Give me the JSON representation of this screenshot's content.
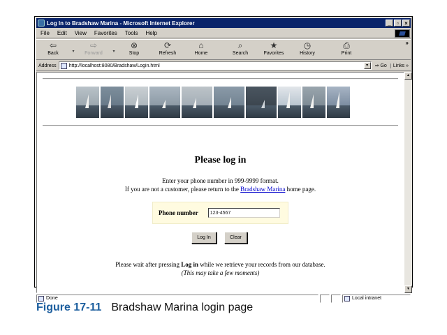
{
  "window": {
    "title": "Log In to Bradshaw Marina - Microsoft Internet Explorer"
  },
  "menu": [
    {
      "label": "File"
    },
    {
      "label": "Edit"
    },
    {
      "label": "View"
    },
    {
      "label": "Favorites"
    },
    {
      "label": "Tools"
    },
    {
      "label": "Help"
    }
  ],
  "toolbar": {
    "back": {
      "label": "Back",
      "icon": "back-arrow-icon"
    },
    "forward": {
      "label": "Forward",
      "icon": "forward-arrow-icon"
    },
    "stop": {
      "label": "Stop",
      "icon": "stop-icon"
    },
    "refresh": {
      "label": "Refresh",
      "icon": "refresh-icon"
    },
    "home": {
      "label": "Home",
      "icon": "home-icon"
    },
    "search": {
      "label": "Search",
      "icon": "search-icon"
    },
    "favorites": {
      "label": "Favorites",
      "icon": "favorites-icon"
    },
    "history": {
      "label": "History",
      "icon": "history-icon"
    },
    "print": {
      "label": "Print",
      "icon": "print-icon"
    },
    "overflow": "»"
  },
  "address": {
    "label": "Address",
    "url": "http://localhost:8080/Bradshaw/Login.html",
    "go": "Go",
    "links": "Links »"
  },
  "page": {
    "heading": "Please log in",
    "instruction1": "Enter your phone number in 999-9999 format.",
    "instruction2_pre": "If you are not a customer, please return to the ",
    "instruction2_link": "Bradshaw Marina",
    "instruction2_post": " home page.",
    "phone_label": "Phone number",
    "phone_value": "123-4567",
    "login_button": "Log In",
    "clear_button": "Clear",
    "wait_pre": "Please wait after pressing ",
    "wait_bold": "Log in",
    "wait_post": " while we retrieve your records from our database.",
    "wait_note": "(This may take a few moments)",
    "photo_count_note": "sailboat photos"
  },
  "status": {
    "text": "Done",
    "zone": "Local intranet"
  },
  "caption": {
    "number": "Figure 17-11",
    "text": "Bradshaw Marina login page"
  },
  "colors": {
    "titlebar": "#0a246a",
    "link": "#0000cc",
    "caption_number": "#1c5e9e",
    "form_bg": "#fffbe0"
  }
}
